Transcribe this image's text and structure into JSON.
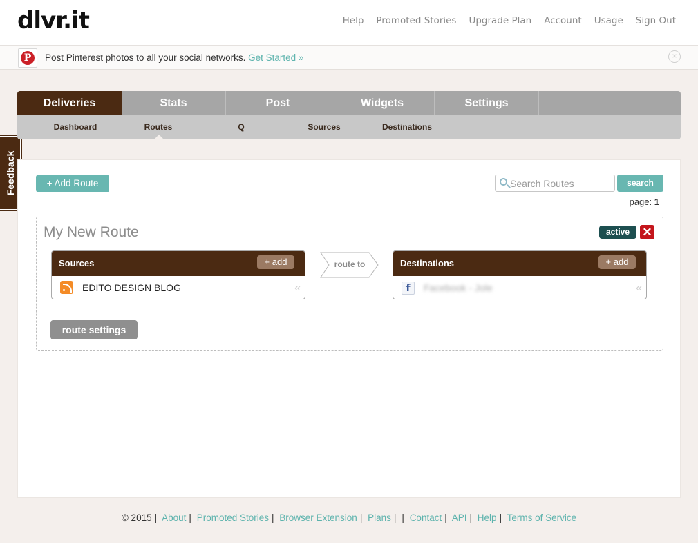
{
  "header": {
    "logo": "dlvr.it",
    "nav": [
      "Help",
      "Promoted Stories",
      "Upgrade Plan",
      "Account",
      "Usage",
      "Sign Out"
    ]
  },
  "promo": {
    "text": "Post Pinterest photos to all your social networks.",
    "link": "Get Started »",
    "pin_glyph": "P",
    "close_glyph": "×"
  },
  "feedback": {
    "label": "Feedback"
  },
  "main_tabs": [
    "Deliveries",
    "Stats",
    "Post",
    "Widgets",
    "Settings"
  ],
  "sub_tabs": [
    "Dashboard",
    "Routes",
    "Q",
    "Sources",
    "Destinations"
  ],
  "toolbar": {
    "add_route": "+ Add Route",
    "search_placeholder": "Search Routes",
    "search_button": "search",
    "page_label": "page:",
    "page_number": "1"
  },
  "route": {
    "title": "My New Route",
    "status": "active",
    "delete_glyph": "✕",
    "sources": {
      "header": "Sources",
      "add": "+ add",
      "item": "EDITO DESIGN BLOG"
    },
    "arrow_label": "route to",
    "destinations": {
      "header": "Destinations",
      "add": "+ add",
      "item": "Facebook - Jole"
    },
    "collapse_glyph": "«",
    "settings_button": "route settings"
  },
  "footer": {
    "copyright": "© 2015",
    "links": [
      "About",
      "Promoted Stories",
      "Browser Extension",
      "Plans",
      "",
      "Contact",
      "API",
      "Help",
      "Terms of Service"
    ]
  },
  "colors": {
    "brand_brown": "#4b2a12",
    "accent_teal": "#68b7b1",
    "active_badge": "#1d4f50",
    "delete_red": "#c4161c"
  }
}
